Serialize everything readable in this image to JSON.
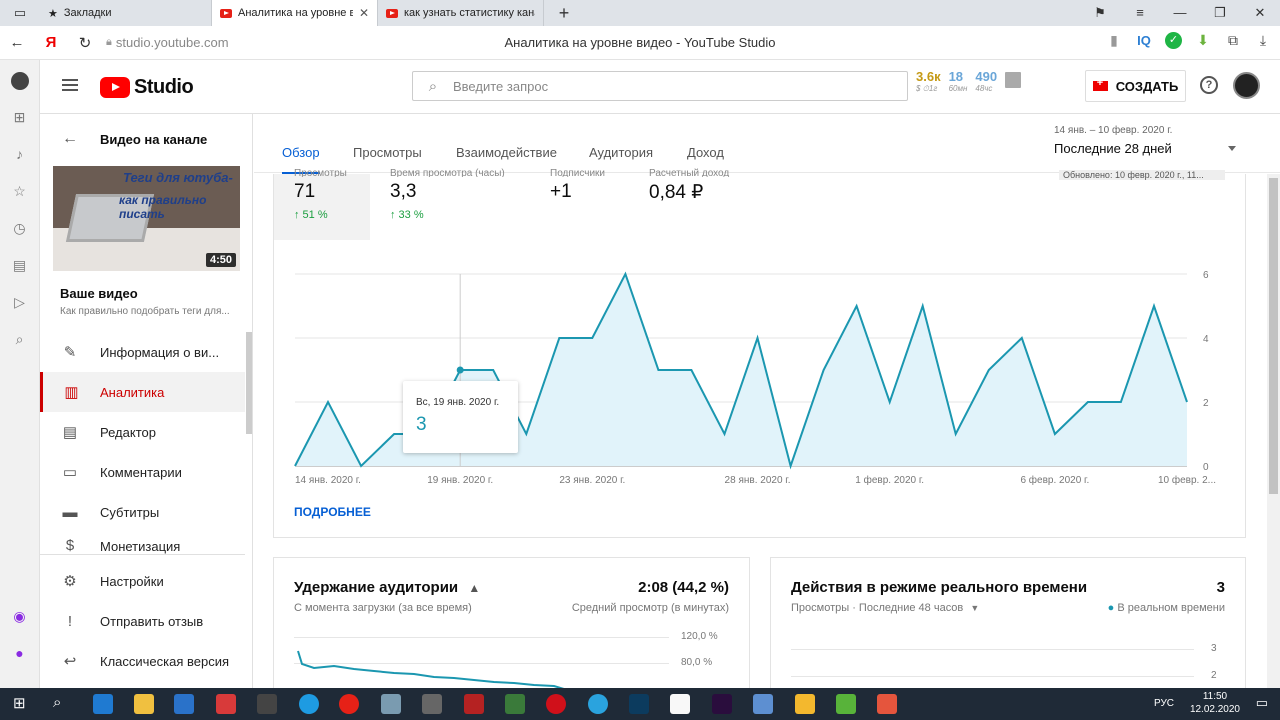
{
  "browser": {
    "tabs": [
      {
        "label": "Закладки"
      },
      {
        "label": "Аналитика на уровне ви"
      },
      {
        "label": "как узнать статистику кана"
      }
    ],
    "host": "studio.youtube.com",
    "page_title": "Аналитика на уровне видео - YouTube Studio",
    "ext_iq": "IQ"
  },
  "header": {
    "logo_text": "Studio",
    "search_placeholder": "Введите запрос",
    "stats": [
      {
        "value": "3.6к",
        "sub": "$ ⏱1г",
        "color": "#c59a16"
      },
      {
        "value": "18",
        "sub": "60мн",
        "color": "#6aa6d8"
      },
      {
        "value": "490",
        "sub": "48чс",
        "color": "#6aa6d8"
      }
    ],
    "create_label": "СОЗДАТЬ",
    "help": "?"
  },
  "sidebar": {
    "back_title": "Видео на канале",
    "thumb_text1": "Теги для ютуба-",
    "thumb_text2": "как правильно писать",
    "duration": "4:50",
    "your_video": "Ваше видео",
    "video_name": "Как правильно подобрать теги для...",
    "items": [
      {
        "label": "Информация о ви...",
        "icon": "✎"
      },
      {
        "label": "Аналитика",
        "icon": "▥"
      },
      {
        "label": "Редактор",
        "icon": "▤"
      },
      {
        "label": "Комментарии",
        "icon": "▭"
      },
      {
        "label": "Субтитры",
        "icon": "▬"
      },
      {
        "label": "Монетизация",
        "icon": "$"
      },
      {
        "label": "Настройки",
        "icon": "⚙"
      },
      {
        "label": "Отправить отзыв",
        "icon": "!"
      },
      {
        "label": "Классическая версия",
        "icon": "↩"
      }
    ]
  },
  "main": {
    "tabs": [
      "Обзор",
      "Просмотры",
      "Взаимодействие",
      "Аудитория",
      "Доход"
    ],
    "date_small": "14 янв. – 10 февр. 2020 г.",
    "date_big": "Последние 28 дней",
    "kpis": [
      {
        "label": "Просмотры",
        "value": "71",
        "delta": "↑ 51 %"
      },
      {
        "label": "Время просмотра (часы)",
        "value": "3,3",
        "delta": "↑ 33 %"
      },
      {
        "label": "Подписчики",
        "value": "+1",
        "delta": ""
      },
      {
        "label": "Расчетный доход",
        "value": "0,84 ₽",
        "delta": ""
      }
    ],
    "updated": "Обновлено: 10 февр. 2020 г., 11...",
    "tooltip_date": "Вс, 19 янв. 2020 г.",
    "tooltip_value": "3",
    "more_label": "ПОДРОБНЕЕ"
  },
  "chart_data": {
    "type": "area",
    "x": [
      "14 янв.",
      "15 янв.",
      "16 янв.",
      "17 янв.",
      "18 янв.",
      "19 янв.",
      "20 янв.",
      "21 янв.",
      "22 янв.",
      "23 янв.",
      "24 янв.",
      "25 янв.",
      "26 янв.",
      "27 янв.",
      "28 янв.",
      "29 янв.",
      "30 янв.",
      "31 янв.",
      "1 февр.",
      "2 февр.",
      "3 февр.",
      "4 февр.",
      "5 февр.",
      "6 февр.",
      "7 февр.",
      "8 февр.",
      "9 февр.",
      "10 февр."
    ],
    "values": [
      0,
      2,
      0,
      1,
      1,
      3,
      3,
      1,
      4,
      4,
      6,
      3,
      3,
      1,
      4,
      0,
      3,
      5,
      2,
      5,
      1,
      3,
      4,
      1,
      2,
      2,
      5,
      2
    ],
    "xticks": [
      "14 янв. 2020 г.",
      "19 янв. 2020 г.",
      "23 янв. 2020 г.",
      "28 янв. 2020 г.",
      "1 февр. 2020 г.",
      "6 февр. 2020 г.",
      "10 февр. 2..."
    ],
    "xtick_index": [
      0,
      5,
      9,
      14,
      18,
      23,
      27
    ],
    "yticks": [
      "0",
      "2",
      "4",
      "6"
    ],
    "ylim": [
      0,
      6
    ],
    "line_color": "#1b97b0",
    "fill_color": "#e1f3fa",
    "highlight_index": 5
  },
  "retention": {
    "title": "Удержание аудитории",
    "sub": "С момента загрузки (за все время)",
    "value": "2:08 (44,2 %)",
    "value_sub": "Средний просмотр (в минутах)",
    "yticks": [
      "120,0 %",
      "80,0 %"
    ]
  },
  "realtime": {
    "title": "Действия в режиме реального времени",
    "sub": "Просмотры · Последние 48 часов",
    "value": "3",
    "value_sub": "В реальном времени",
    "yticks": [
      "3",
      "2"
    ]
  },
  "taskbar": {
    "lang": "РУС",
    "time": "11:50",
    "date": "12.02.2020"
  }
}
